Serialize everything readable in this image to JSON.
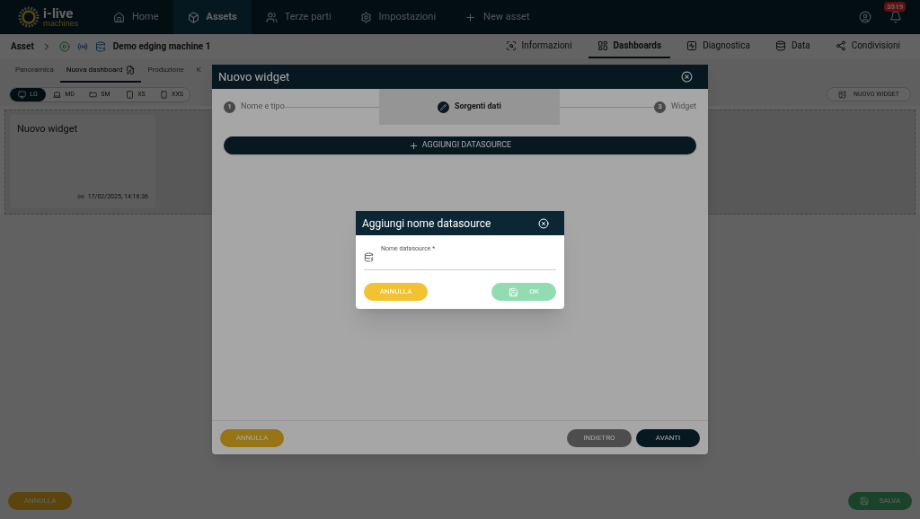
{
  "logo": {
    "name": "i-live",
    "tagline": "machines"
  },
  "nav": [
    {
      "label": "Home",
      "selected": false
    },
    {
      "label": "Assets",
      "selected": true
    },
    {
      "label": "Terze parti",
      "selected": false
    },
    {
      "label": "Impostazioni",
      "selected": false
    },
    {
      "label": "New asset",
      "selected": false
    }
  ],
  "notifications": {
    "count": "3519"
  },
  "breadcrumb": {
    "root": "Asset",
    "asset": "Demo edging machine 1"
  },
  "asset_tabs": [
    {
      "label": "Informazioni",
      "selected": false
    },
    {
      "label": "Dashboards",
      "selected": true
    },
    {
      "label": "Diagnostica",
      "selected": false
    },
    {
      "label": "Data",
      "selected": false
    },
    {
      "label": "Condivisioni",
      "selected": false
    }
  ],
  "dashboard_tabs": [
    {
      "label": "Panoramica",
      "selected": false,
      "editing": false
    },
    {
      "label": "Nuova dashboard",
      "selected": true,
      "editing": true
    },
    {
      "label": "Produzione",
      "selected": false,
      "editing": false
    },
    {
      "label": "K",
      "selected": false,
      "editing": false
    }
  ],
  "sizes": [
    {
      "label": "LG",
      "selected": true
    },
    {
      "label": "MD",
      "selected": false
    },
    {
      "label": "SM",
      "selected": false
    },
    {
      "label": "XS",
      "selected": false
    },
    {
      "label": "XXS",
      "selected": false
    }
  ],
  "new_widget_button": "NUOVO WIDGET",
  "widgets": [
    {
      "title": "Nuovo widget",
      "timestamp": "17/02/2025, 14:16:36"
    }
  ],
  "page_buttons": {
    "cancel": "ANNULLA",
    "save": "SALVA"
  },
  "modal": {
    "title": "Nuovo widget",
    "steps": [
      {
        "number": "1",
        "label": "Nome e tipo",
        "selected": false
      },
      {
        "label": "Sorgenti dati",
        "selected": true
      },
      {
        "number": "3",
        "label": "Widget",
        "selected": false
      }
    ],
    "add_button": "AGGIUNGI DATASOURCE",
    "cancel": "ANNULLA",
    "back": "INDIETRO",
    "next": "AVANTI"
  },
  "dialog": {
    "title": "Aggiungi nome datasource",
    "field_label": "Nome datasource *",
    "cancel": "ANNULLA",
    "ok": "OK",
    "ok_disabled": true
  }
}
